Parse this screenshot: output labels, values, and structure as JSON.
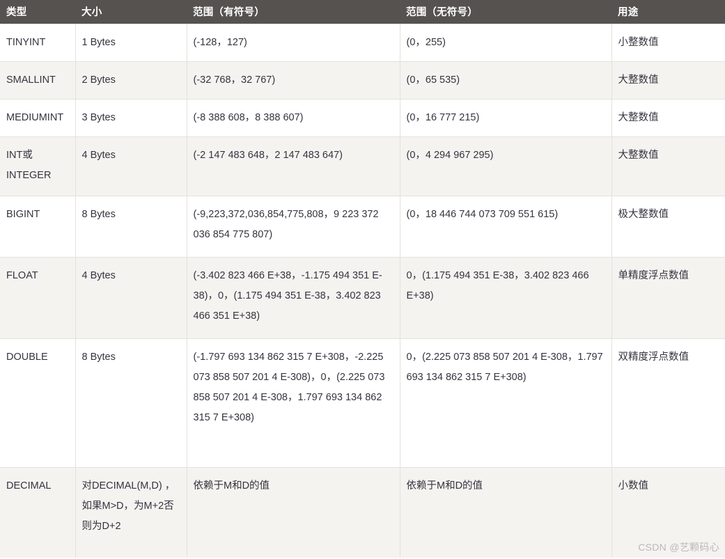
{
  "table": {
    "columns": [
      {
        "key": "type",
        "label": "类型"
      },
      {
        "key": "size",
        "label": "大小"
      },
      {
        "key": "signed",
        "label": "范围（有符号）"
      },
      {
        "key": "unsigned",
        "label": "范围（无符号）"
      },
      {
        "key": "usage",
        "label": "用途"
      }
    ],
    "rows": [
      {
        "type": "TINYINT",
        "size": "1 Bytes",
        "signed": "(-128，127)",
        "unsigned": "(0，255)",
        "usage": "小整数值"
      },
      {
        "type": "SMALLINT",
        "size": "2 Bytes",
        "signed": "(-32 768，32 767)",
        "unsigned": "(0，65 535)",
        "usage": "大整数值"
      },
      {
        "type": "MEDIUMINT",
        "size": "3 Bytes",
        "signed": "(-8 388 608，8 388 607)",
        "unsigned": "(0，16 777 215)",
        "usage": "大整数值"
      },
      {
        "type": "INT或INTEGER",
        "size": "4 Bytes",
        "signed": "(-2 147 483 648，2 147 483 647)",
        "unsigned": "(0，4 294 967 295)",
        "usage": "大整数值"
      },
      {
        "type": "BIGINT",
        "size": "8 Bytes",
        "signed": "(-9,223,372,036,854,775,808，9 223 372 036 854 775 807)",
        "unsigned": "(0，18 446 744 073 709 551 615)",
        "usage": "极大整数值"
      },
      {
        "type": "FLOAT",
        "size": "4 Bytes",
        "signed": "(-3.402 823 466 E+38，-1.175 494 351 E-38)，0，(1.175 494 351 E-38，3.402 823 466 351 E+38)",
        "unsigned": "0，(1.175 494 351 E-38，3.402 823 466 E+38)",
        "usage": "单精度浮点数值"
      },
      {
        "type": "DOUBLE",
        "size": "8 Bytes",
        "signed": "(-1.797 693 134 862 315 7 E+308，-2.225 073 858 507 201 4 E-308)，0，(2.225 073 858 507 201 4 E-308，1.797 693 134 862 315 7 E+308)",
        "unsigned": "0，(2.225 073 858 507 201 4 E-308，1.797 693 134 862 315 7 E+308)",
        "usage": "双精度浮点数值"
      },
      {
        "type": "DECIMAL",
        "size": "对DECIMAL(M,D) ，如果M>D，为M+2否则为D+2",
        "signed": "依赖于M和D的值",
        "unsigned": "依赖于M和D的值",
        "usage": "小数值"
      }
    ]
  },
  "watermark": {
    "text": "CSDN @艺颗码心"
  },
  "colors": {
    "header_background": "#55524f",
    "header_text": "#ffffff",
    "row_odd_background": "#ffffff",
    "row_even_background": "#f5f3f0",
    "cell_border": "#e3e1de",
    "body_text": "#34343f",
    "watermark_text": "#b9b9b9"
  }
}
